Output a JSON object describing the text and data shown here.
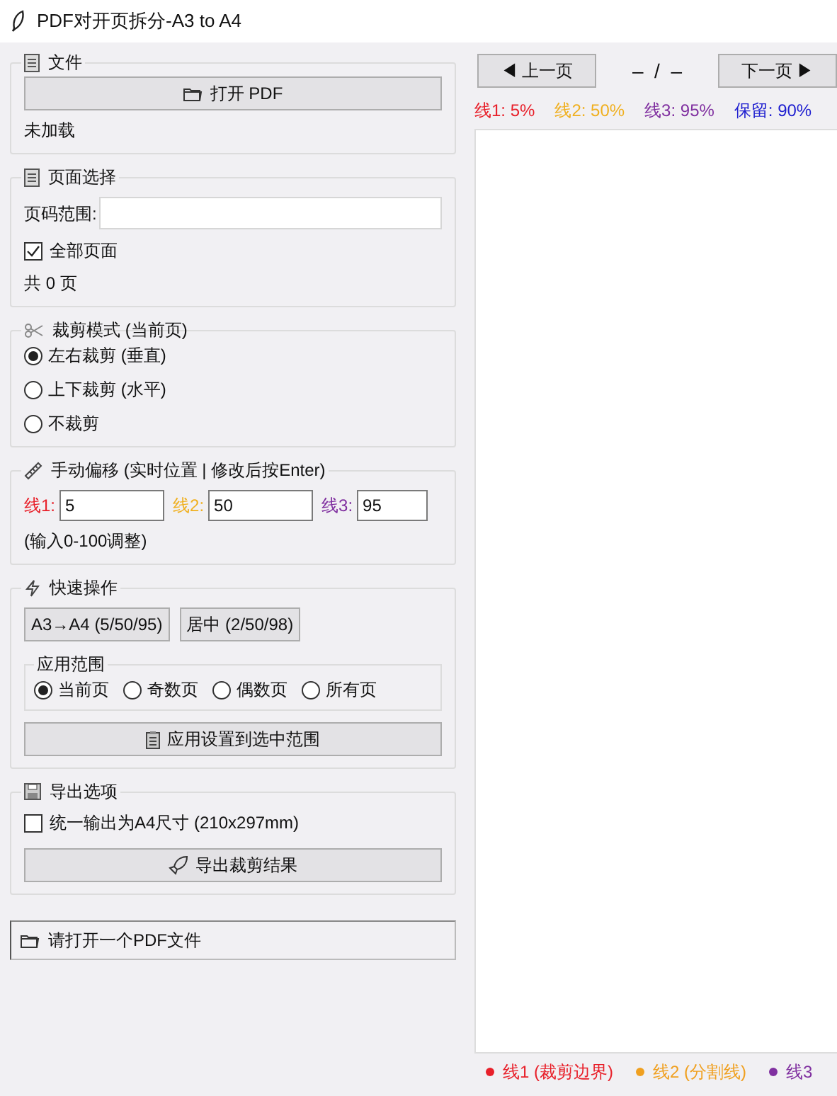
{
  "window": {
    "title": "PDF对开页拆分-A3 to A4"
  },
  "file_section": {
    "title": "文件",
    "open_button": "打开 PDF",
    "status": "未加载"
  },
  "page_selection": {
    "title": "页面选择",
    "range_label": "页码范围:",
    "all_pages": {
      "label": "全部页面",
      "checked": true
    },
    "count": "共 0 页"
  },
  "crop_mode": {
    "title": "裁剪模式 (当前页)",
    "options": [
      {
        "label": "左右裁剪 (垂直)",
        "selected": true
      },
      {
        "label": "上下裁剪 (水平)",
        "selected": false
      },
      {
        "label": "不裁剪",
        "selected": false
      }
    ]
  },
  "manual_offset": {
    "title": "手动偏移 (实时位置 | 修改后按Enter)",
    "lines": [
      {
        "label": "线1:",
        "value": "5",
        "color": "#e8202a"
      },
      {
        "label": "线2:",
        "value": "50",
        "color": "#f0b020"
      },
      {
        "label": "线3:",
        "value": "95",
        "color": "#8030a0"
      }
    ],
    "hint": "(输入0-100调整)"
  },
  "quick_actions": {
    "title": "快速操作",
    "presets": [
      "A3→A4 (5/50/95)",
      "居中 (2/50/98)"
    ],
    "scope": {
      "title": "应用范围",
      "options": [
        {
          "label": "当前页",
          "selected": true
        },
        {
          "label": "奇数页",
          "selected": false
        },
        {
          "label": "偶数页",
          "selected": false
        },
        {
          "label": "所有页",
          "selected": false
        }
      ]
    },
    "apply_button": "应用设置到选中范围"
  },
  "export": {
    "title": "导出选项",
    "a4_checkbox": {
      "label": "统一输出为A4尺寸 (210x297mm)",
      "checked": false
    },
    "export_button": "导出裁剪结果"
  },
  "status_bar": {
    "text": "请打开一个PDF文件"
  },
  "navigation": {
    "prev_button": "◀ 上一页",
    "page_indicator": "–  /  –",
    "next_button": "下一页 ▶"
  },
  "line_readouts": [
    {
      "text": "线1: 5%",
      "color": "#e8202a"
    },
    {
      "text": "线2: 50%",
      "color": "#f0b020"
    },
    {
      "text": "线3: 95%",
      "color": "#8030a0"
    },
    {
      "text": "保留: 90%",
      "color": "#2020d0"
    }
  ],
  "legend": [
    {
      "text": "线1 (裁剪边界)",
      "color": "#e8202a"
    },
    {
      "text": "线2 (分割线)",
      "color": "#f0a020"
    },
    {
      "text": "线3",
      "color": "#8030a0"
    }
  ]
}
